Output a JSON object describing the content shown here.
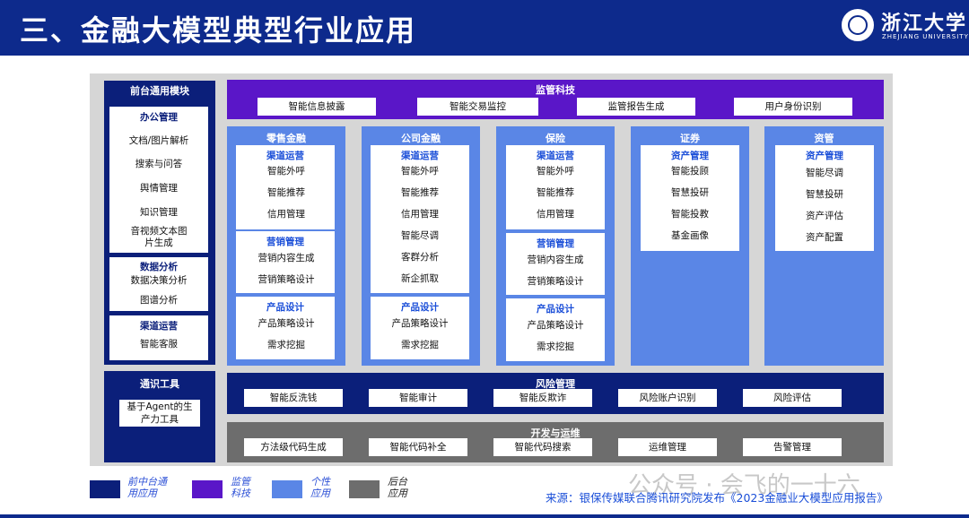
{
  "header": {
    "title": "三、金融大模型典型行业应用",
    "university_name": "浙江大学",
    "university_en": "ZHEJIANG UNIVERSITY"
  },
  "front_general": {
    "title": "前台通用模块",
    "office": {
      "title": "办公管理",
      "items": [
        "文档/图片解析",
        "搜索与问答",
        "舆情管理",
        "知识管理",
        "音视频文本图片生成"
      ]
    },
    "data_analysis": {
      "title": "数据分析",
      "items": [
        "数据决策分析",
        "图谱分析"
      ]
    },
    "channel_ops": {
      "title": "渠道运营",
      "items": [
        "智能客服"
      ]
    }
  },
  "general_tools": {
    "title": "通识工具",
    "items": [
      "基于Agent的生产力工具"
    ]
  },
  "regulatory_tech": {
    "title": "监管科技",
    "items": [
      "智能信息披露",
      "智能交易监控",
      "监管报告生成",
      "用户身份识别"
    ]
  },
  "retail": {
    "title": "零售金融",
    "sections": [
      {
        "title": "渠道运营",
        "items": [
          "智能外呼",
          "智能推荐",
          "信用管理"
        ]
      },
      {
        "title": "营销管理",
        "items": [
          "营销内容生成",
          "营销策略设计"
        ]
      },
      {
        "title": "产品设计",
        "items": [
          "产品策略设计",
          "需求挖掘"
        ]
      }
    ]
  },
  "corporate": {
    "title": "公司金融",
    "sections": [
      {
        "title": "渠道运营",
        "items": [
          "智能外呼",
          "智能推荐",
          "信用管理",
          "智能尽调",
          "客群分析",
          "新企抓取"
        ]
      },
      {
        "title": "产品设计",
        "items": [
          "产品策略设计",
          "需求挖掘"
        ]
      }
    ]
  },
  "insurance": {
    "title": "保险",
    "sections": [
      {
        "title": "渠道运营",
        "items": [
          "智能外呼",
          "智能推荐",
          "信用管理"
        ]
      },
      {
        "title": "营销管理",
        "items": [
          "营销内容生成",
          "营销策略设计"
        ]
      },
      {
        "title": "产品设计",
        "items": [
          "产品策略设计",
          "需求挖掘"
        ]
      }
    ]
  },
  "securities": {
    "title": "证券",
    "sections": [
      {
        "title": "资产管理",
        "items": [
          "智能投顾",
          "智慧投研",
          "智能投教",
          "基金画像"
        ]
      }
    ]
  },
  "asset_mgmt": {
    "title": "资管",
    "sections": [
      {
        "title": "资产管理",
        "items": [
          "智能尽调",
          "智慧投研",
          "资产评估",
          "资产配置"
        ]
      }
    ]
  },
  "risk": {
    "title": "风险管理",
    "items": [
      "智能反洗钱",
      "智能审计",
      "智能反欺诈",
      "风险账户识别",
      "风险评估"
    ]
  },
  "devops": {
    "title": "开发与运维",
    "items": [
      "方法级代码生成",
      "智能代码补全",
      "智能代码搜索",
      "运维管理",
      "告警管理"
    ]
  },
  "legend": [
    {
      "label": "前中台通用应用",
      "color": "#0b1f7a"
    },
    {
      "label": "监管科技",
      "color": "#5a16c8"
    },
    {
      "label": "个性应用",
      "color": "#5a86e6"
    },
    {
      "label": "后台应用",
      "color": "#6d6d6d"
    }
  ],
  "source": "来源：银保传媒联合腾讯研究院发布《2023金融业大模型应用报告》",
  "watermark": "公众号 · 会飞的一十六"
}
